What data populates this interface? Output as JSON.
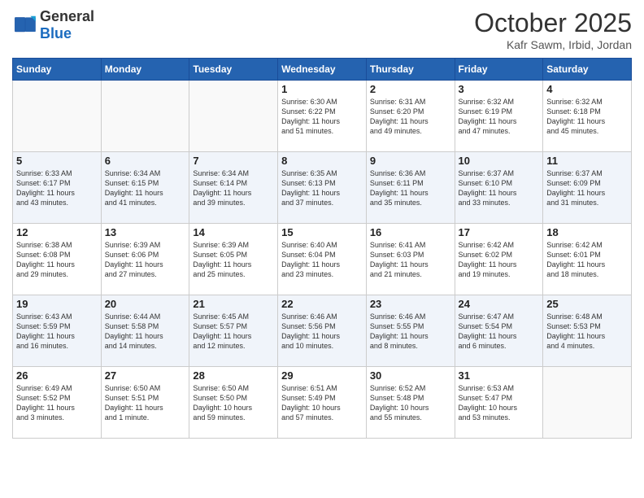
{
  "header": {
    "logo_general": "General",
    "logo_blue": "Blue",
    "month": "October 2025",
    "location": "Kafr Sawm, Irbid, Jordan"
  },
  "days_of_week": [
    "Sunday",
    "Monday",
    "Tuesday",
    "Wednesday",
    "Thursday",
    "Friday",
    "Saturday"
  ],
  "weeks": [
    [
      {
        "day": "",
        "info": ""
      },
      {
        "day": "",
        "info": ""
      },
      {
        "day": "",
        "info": ""
      },
      {
        "day": "1",
        "info": "Sunrise: 6:30 AM\nSunset: 6:22 PM\nDaylight: 11 hours\nand 51 minutes."
      },
      {
        "day": "2",
        "info": "Sunrise: 6:31 AM\nSunset: 6:20 PM\nDaylight: 11 hours\nand 49 minutes."
      },
      {
        "day": "3",
        "info": "Sunrise: 6:32 AM\nSunset: 6:19 PM\nDaylight: 11 hours\nand 47 minutes."
      },
      {
        "day": "4",
        "info": "Sunrise: 6:32 AM\nSunset: 6:18 PM\nDaylight: 11 hours\nand 45 minutes."
      }
    ],
    [
      {
        "day": "5",
        "info": "Sunrise: 6:33 AM\nSunset: 6:17 PM\nDaylight: 11 hours\nand 43 minutes."
      },
      {
        "day": "6",
        "info": "Sunrise: 6:34 AM\nSunset: 6:15 PM\nDaylight: 11 hours\nand 41 minutes."
      },
      {
        "day": "7",
        "info": "Sunrise: 6:34 AM\nSunset: 6:14 PM\nDaylight: 11 hours\nand 39 minutes."
      },
      {
        "day": "8",
        "info": "Sunrise: 6:35 AM\nSunset: 6:13 PM\nDaylight: 11 hours\nand 37 minutes."
      },
      {
        "day": "9",
        "info": "Sunrise: 6:36 AM\nSunset: 6:11 PM\nDaylight: 11 hours\nand 35 minutes."
      },
      {
        "day": "10",
        "info": "Sunrise: 6:37 AM\nSunset: 6:10 PM\nDaylight: 11 hours\nand 33 minutes."
      },
      {
        "day": "11",
        "info": "Sunrise: 6:37 AM\nSunset: 6:09 PM\nDaylight: 11 hours\nand 31 minutes."
      }
    ],
    [
      {
        "day": "12",
        "info": "Sunrise: 6:38 AM\nSunset: 6:08 PM\nDaylight: 11 hours\nand 29 minutes."
      },
      {
        "day": "13",
        "info": "Sunrise: 6:39 AM\nSunset: 6:06 PM\nDaylight: 11 hours\nand 27 minutes."
      },
      {
        "day": "14",
        "info": "Sunrise: 6:39 AM\nSunset: 6:05 PM\nDaylight: 11 hours\nand 25 minutes."
      },
      {
        "day": "15",
        "info": "Sunrise: 6:40 AM\nSunset: 6:04 PM\nDaylight: 11 hours\nand 23 minutes."
      },
      {
        "day": "16",
        "info": "Sunrise: 6:41 AM\nSunset: 6:03 PM\nDaylight: 11 hours\nand 21 minutes."
      },
      {
        "day": "17",
        "info": "Sunrise: 6:42 AM\nSunset: 6:02 PM\nDaylight: 11 hours\nand 19 minutes."
      },
      {
        "day": "18",
        "info": "Sunrise: 6:42 AM\nSunset: 6:01 PM\nDaylight: 11 hours\nand 18 minutes."
      }
    ],
    [
      {
        "day": "19",
        "info": "Sunrise: 6:43 AM\nSunset: 5:59 PM\nDaylight: 11 hours\nand 16 minutes."
      },
      {
        "day": "20",
        "info": "Sunrise: 6:44 AM\nSunset: 5:58 PM\nDaylight: 11 hours\nand 14 minutes."
      },
      {
        "day": "21",
        "info": "Sunrise: 6:45 AM\nSunset: 5:57 PM\nDaylight: 11 hours\nand 12 minutes."
      },
      {
        "day": "22",
        "info": "Sunrise: 6:46 AM\nSunset: 5:56 PM\nDaylight: 11 hours\nand 10 minutes."
      },
      {
        "day": "23",
        "info": "Sunrise: 6:46 AM\nSunset: 5:55 PM\nDaylight: 11 hours\nand 8 minutes."
      },
      {
        "day": "24",
        "info": "Sunrise: 6:47 AM\nSunset: 5:54 PM\nDaylight: 11 hours\nand 6 minutes."
      },
      {
        "day": "25",
        "info": "Sunrise: 6:48 AM\nSunset: 5:53 PM\nDaylight: 11 hours\nand 4 minutes."
      }
    ],
    [
      {
        "day": "26",
        "info": "Sunrise: 6:49 AM\nSunset: 5:52 PM\nDaylight: 11 hours\nand 3 minutes."
      },
      {
        "day": "27",
        "info": "Sunrise: 6:50 AM\nSunset: 5:51 PM\nDaylight: 11 hours\nand 1 minute."
      },
      {
        "day": "28",
        "info": "Sunrise: 6:50 AM\nSunset: 5:50 PM\nDaylight: 10 hours\nand 59 minutes."
      },
      {
        "day": "29",
        "info": "Sunrise: 6:51 AM\nSunset: 5:49 PM\nDaylight: 10 hours\nand 57 minutes."
      },
      {
        "day": "30",
        "info": "Sunrise: 6:52 AM\nSunset: 5:48 PM\nDaylight: 10 hours\nand 55 minutes."
      },
      {
        "day": "31",
        "info": "Sunrise: 6:53 AM\nSunset: 5:47 PM\nDaylight: 10 hours\nand 53 minutes."
      },
      {
        "day": "",
        "info": ""
      }
    ]
  ]
}
